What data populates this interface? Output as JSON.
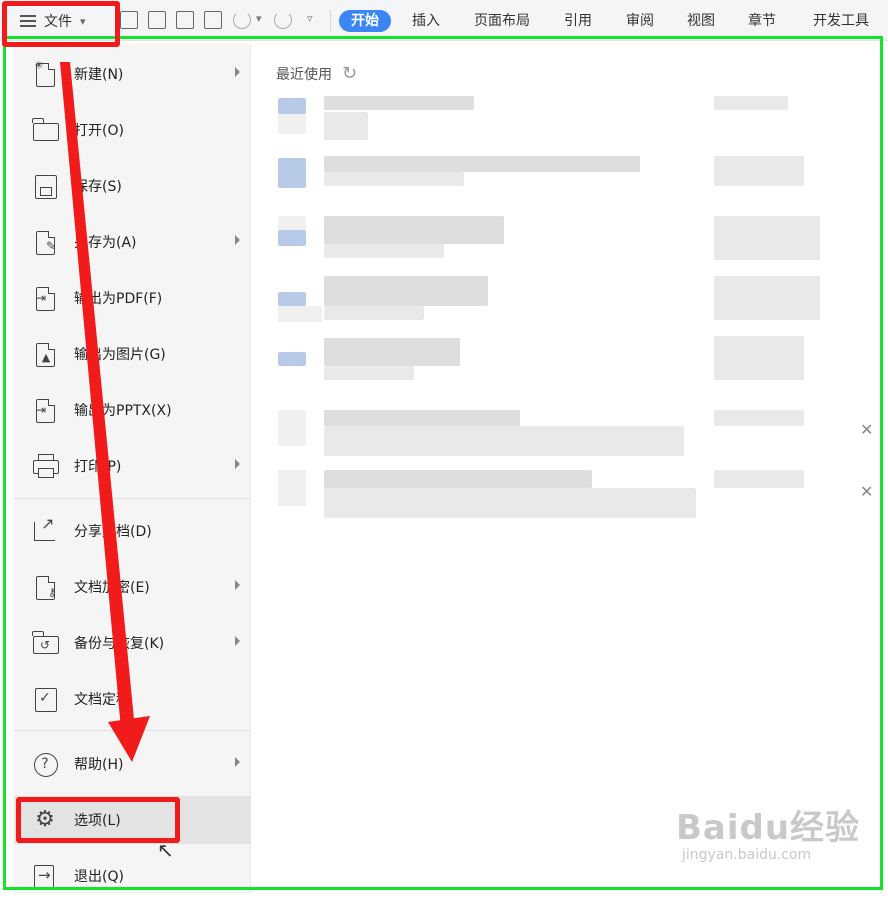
{
  "toolbar": {
    "file_label": "文件",
    "tabs": [
      "开始",
      "插入",
      "页面布局",
      "引用",
      "审阅",
      "视图",
      "章节",
      "开发工具"
    ],
    "active_tab": "开始",
    "accent": "#3b86f5"
  },
  "menu": {
    "items": [
      {
        "label": "新建(N)",
        "icon": "new-document-icon",
        "submenu": true
      },
      {
        "label": "打开(O)",
        "icon": "folder-icon",
        "submenu": false
      },
      {
        "label": "保存(S)",
        "icon": "save-icon",
        "submenu": false
      },
      {
        "label": "另存为(A)",
        "icon": "save-as-icon",
        "submenu": true
      },
      {
        "label": "输出为PDF(F)",
        "icon": "export-pdf-icon",
        "submenu": false
      },
      {
        "label": "输出为图片(G)",
        "icon": "export-image-icon",
        "submenu": false
      },
      {
        "label": "输出为PPTX(X)",
        "icon": "export-pptx-icon",
        "submenu": false
      },
      {
        "label": "打印(P)",
        "icon": "printer-icon",
        "submenu": true
      },
      {
        "label": "分享文档(D)",
        "icon": "share-icon",
        "submenu": false
      },
      {
        "label": "文档加密(E)",
        "icon": "encrypt-document-icon",
        "submenu": true
      },
      {
        "label": "备份与恢复(K)",
        "icon": "backup-restore-icon",
        "submenu": true
      },
      {
        "label": "文档定稿",
        "icon": "finalize-document-icon",
        "submenu": false
      },
      {
        "label": "帮助(H)",
        "icon": "help-icon",
        "submenu": true
      },
      {
        "label": "选项(L)",
        "icon": "gear-icon",
        "submenu": false,
        "selected": true
      },
      {
        "label": "退出(Q)",
        "icon": "exit-icon",
        "submenu": false
      }
    ]
  },
  "recent": {
    "header": "最近使用"
  },
  "watermark": {
    "brand": "Baidu经验",
    "url": "jingyan.baidu.com"
  },
  "colors": {
    "highlight_red": "#f21b1b",
    "frame_green": "#14e52b"
  }
}
